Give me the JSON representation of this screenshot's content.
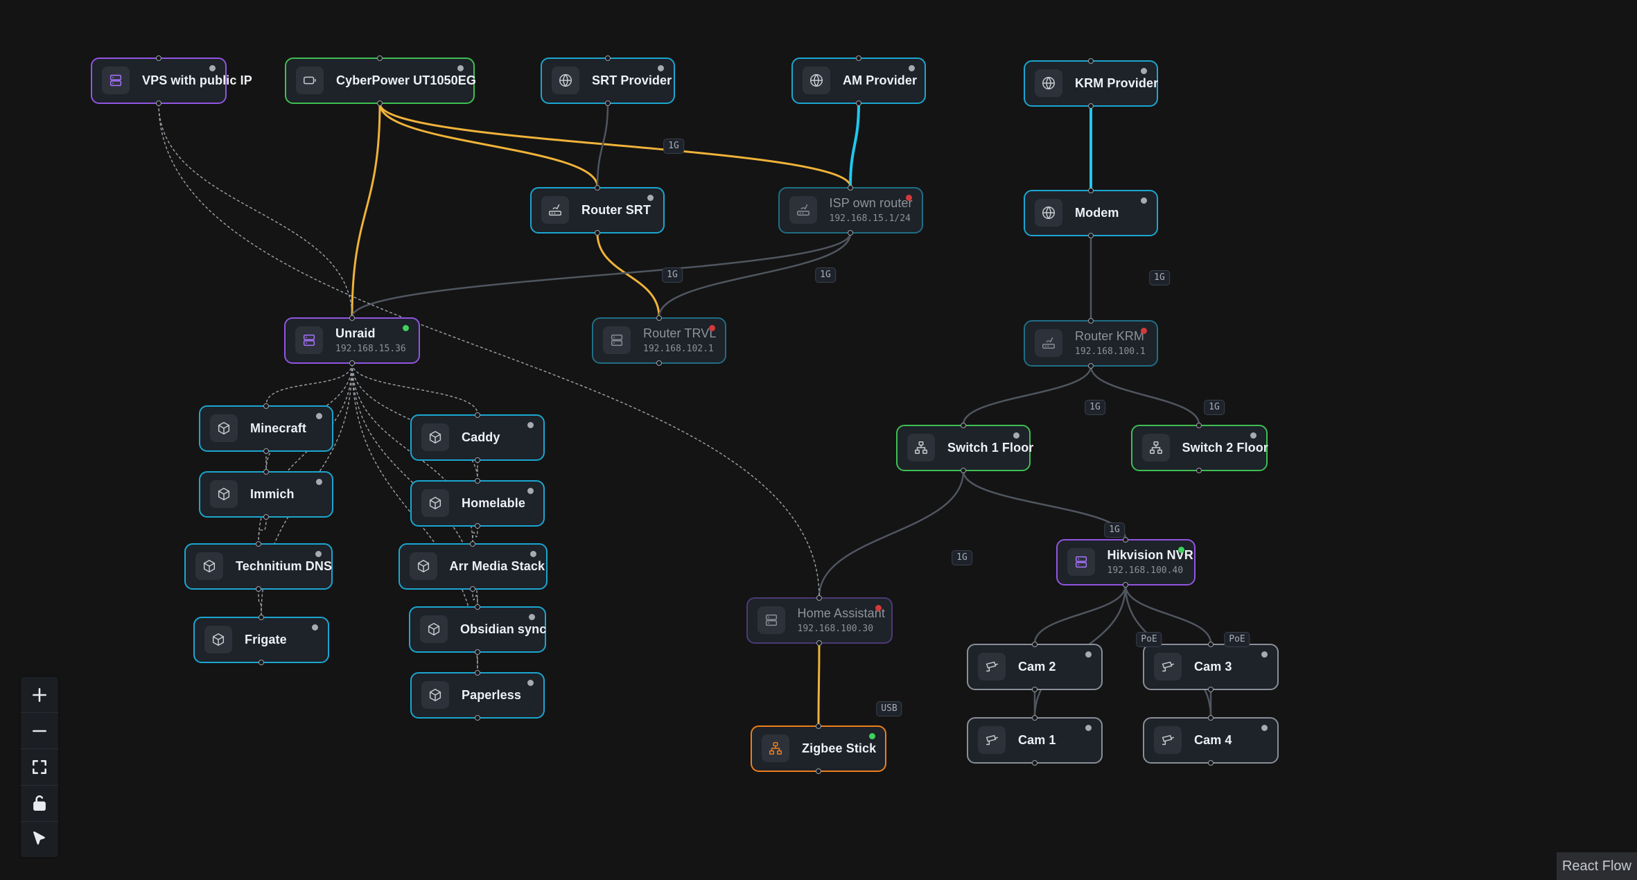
{
  "colors": {
    "background": "#141414",
    "node_bg": "#1e2229",
    "border_purple": "#9155e2",
    "border_green": "#3fbf53",
    "border_cyan": "#1ba7d1",
    "border_orange": "#ef7f1a",
    "edge_power": "#f0b33a",
    "edge_fiber": "#1fc8ef",
    "edge_ethernet": "#505660",
    "edge_dashed": "#9ea4ab",
    "status_online": "#3fd15a",
    "status_offline": "#d23a3a",
    "status_unknown": "#a7abb1"
  },
  "nodes": [
    {
      "id": "vps",
      "label": "VPS with public IP",
      "icon": "server-icon",
      "status": "unknown"
    },
    {
      "id": "ups",
      "label": "CyberPower UT1050EG",
      "icon": "battery-icon",
      "status": "unknown"
    },
    {
      "id": "srt",
      "label": "SRT Provider",
      "icon": "globe-icon",
      "status": "unknown"
    },
    {
      "id": "am",
      "label": "AM Provider",
      "icon": "globe-icon",
      "status": "unknown"
    },
    {
      "id": "krm",
      "label": "KRM Provider",
      "icon": "globe-icon",
      "status": "unknown"
    },
    {
      "id": "rsrt",
      "label": "Router SRT",
      "icon": "router-icon",
      "status": "unknown"
    },
    {
      "id": "isp",
      "label": "ISP own router",
      "ip": "192.168.15.1/24",
      "icon": "router-icon",
      "status": "offline"
    },
    {
      "id": "modem",
      "label": "Modem",
      "icon": "globe-icon",
      "status": "unknown"
    },
    {
      "id": "unraid",
      "label": "Unraid",
      "ip": "192.168.15.36",
      "icon": "server-icon",
      "status": "online"
    },
    {
      "id": "rtrvl",
      "label": "Router TRVL",
      "ip": "192.168.102.1",
      "icon": "server-icon",
      "status": "offline"
    },
    {
      "id": "rkrm",
      "label": "Router KRM",
      "ip": "192.168.100.1",
      "icon": "router-icon",
      "status": "offline"
    },
    {
      "id": "minecraft",
      "label": "Minecraft",
      "icon": "cube-icon",
      "status": "unknown"
    },
    {
      "id": "caddy",
      "label": "Caddy",
      "icon": "cube-icon",
      "status": "unknown"
    },
    {
      "id": "sw1",
      "label": "Switch 1 Floor",
      "icon": "network-icon",
      "status": "unknown"
    },
    {
      "id": "sw2",
      "label": "Switch 2 Floor",
      "icon": "network-icon",
      "status": "unknown"
    },
    {
      "id": "immich",
      "label": "Immich",
      "icon": "cube-icon",
      "status": "unknown"
    },
    {
      "id": "homelable",
      "label": "Homelable",
      "icon": "cube-icon",
      "status": "unknown"
    },
    {
      "id": "techdns",
      "label": "Technitium DNS",
      "icon": "cube-icon",
      "status": "unknown"
    },
    {
      "id": "arr",
      "label": "Arr Media Stack",
      "icon": "cube-icon",
      "status": "unknown"
    },
    {
      "id": "nvr",
      "label": "Hikvision NVR",
      "ip": "192.168.100.40",
      "icon": "server-icon",
      "status": "online"
    },
    {
      "id": "ha",
      "label": "Home Assistant",
      "ip": "192.168.100.30",
      "icon": "server-icon",
      "status": "offline"
    },
    {
      "id": "obsidian",
      "label": "Obsidian sync",
      "icon": "cube-icon",
      "status": "unknown"
    },
    {
      "id": "frigate",
      "label": "Frigate",
      "icon": "cube-icon",
      "status": "unknown"
    },
    {
      "id": "cam2",
      "label": "Cam 2",
      "icon": "camera-icon",
      "status": "unknown"
    },
    {
      "id": "cam3",
      "label": "Cam 3",
      "icon": "camera-icon",
      "status": "unknown"
    },
    {
      "id": "paperless",
      "label": "Paperless",
      "icon": "cube-icon",
      "status": "unknown"
    },
    {
      "id": "zigbee",
      "label": "Zigbee Stick",
      "icon": "network-icon",
      "status": "online"
    },
    {
      "id": "cam1",
      "label": "Cam 1",
      "icon": "camera-icon",
      "status": "unknown"
    },
    {
      "id": "cam4",
      "label": "Cam 4",
      "icon": "camera-icon",
      "status": "unknown"
    }
  ],
  "edges": [
    {
      "from": "ups",
      "to": "unraid",
      "type": "power"
    },
    {
      "from": "ups",
      "to": "rsrt",
      "type": "power"
    },
    {
      "from": "ups",
      "to": "isp",
      "type": "power"
    },
    {
      "from": "rsrt",
      "to": "rtrvl",
      "type": "power"
    },
    {
      "from": "am",
      "to": "isp",
      "type": "fiber"
    },
    {
      "from": "krm",
      "to": "modem",
      "type": "fiber"
    },
    {
      "from": "srt",
      "to": "rsrt",
      "type": "ethernet",
      "label": "1G"
    },
    {
      "from": "isp",
      "to": "unraid",
      "type": "ethernet",
      "label": "1G"
    },
    {
      "from": "isp",
      "to": "rtrvl",
      "type": "ethernet",
      "label": "1G"
    },
    {
      "from": "modem",
      "to": "rkrm",
      "type": "ethernet",
      "label": "1G"
    },
    {
      "from": "rkrm",
      "to": "sw1",
      "type": "ethernet",
      "label": "1G"
    },
    {
      "from": "rkrm",
      "to": "sw2",
      "type": "ethernet",
      "label": "1G"
    },
    {
      "from": "sw1",
      "to": "ha",
      "type": "ethernet",
      "label": "1G"
    },
    {
      "from": "sw1",
      "to": "nvr",
      "type": "ethernet",
      "label": "1G"
    },
    {
      "from": "nvr",
      "to": "cam2",
      "type": "ethernet",
      "label": "PoE"
    },
    {
      "from": "nvr",
      "to": "cam3",
      "type": "ethernet",
      "label": "PoE"
    },
    {
      "from": "nvr",
      "to": "cam1",
      "type": "ethernet"
    },
    {
      "from": "nvr",
      "to": "cam4",
      "type": "ethernet"
    },
    {
      "from": "cam2",
      "to": "cam1",
      "type": "ethernet"
    },
    {
      "from": "cam3",
      "to": "cam4",
      "type": "ethernet"
    },
    {
      "from": "ha",
      "to": "zigbee",
      "type": "power",
      "label": "USB"
    },
    {
      "from": "vps",
      "to": "unraid",
      "type": "dashed"
    },
    {
      "from": "vps",
      "to": "ha",
      "type": "dashed"
    },
    {
      "from": "unraid",
      "to": "minecraft",
      "type": "dashed"
    },
    {
      "from": "unraid",
      "to": "caddy",
      "type": "dashed"
    },
    {
      "from": "unraid",
      "to": "immich",
      "type": "dashed"
    },
    {
      "from": "unraid",
      "to": "homelable",
      "type": "dashed"
    },
    {
      "from": "unraid",
      "to": "techdns",
      "type": "dashed"
    },
    {
      "from": "unraid",
      "to": "arr",
      "type": "dashed"
    },
    {
      "from": "unraid",
      "to": "obsidian",
      "type": "dashed"
    },
    {
      "from": "unraid",
      "to": "frigate",
      "type": "dashed"
    },
    {
      "from": "unraid",
      "to": "paperless",
      "type": "dashed"
    },
    {
      "from": "minecraft",
      "to": "immich",
      "type": "dashed"
    },
    {
      "from": "immich",
      "to": "techdns",
      "type": "dashed"
    },
    {
      "from": "techdns",
      "to": "frigate",
      "type": "dashed"
    },
    {
      "from": "caddy",
      "to": "homelable",
      "type": "dashed"
    },
    {
      "from": "homelable",
      "to": "arr",
      "type": "dashed"
    },
    {
      "from": "arr",
      "to": "obsidian",
      "type": "dashed"
    },
    {
      "from": "obsidian",
      "to": "paperless",
      "type": "dashed"
    }
  ],
  "controls": [
    {
      "name": "zoom-in-button",
      "icon": "plus-icon"
    },
    {
      "name": "zoom-out-button",
      "icon": "minus-icon"
    },
    {
      "name": "fit-view-button",
      "icon": "fit-view-icon"
    },
    {
      "name": "lock-button",
      "icon": "unlock-icon"
    },
    {
      "name": "select-mode-button",
      "icon": "pointer-icon"
    }
  ],
  "attribution": "React Flow"
}
